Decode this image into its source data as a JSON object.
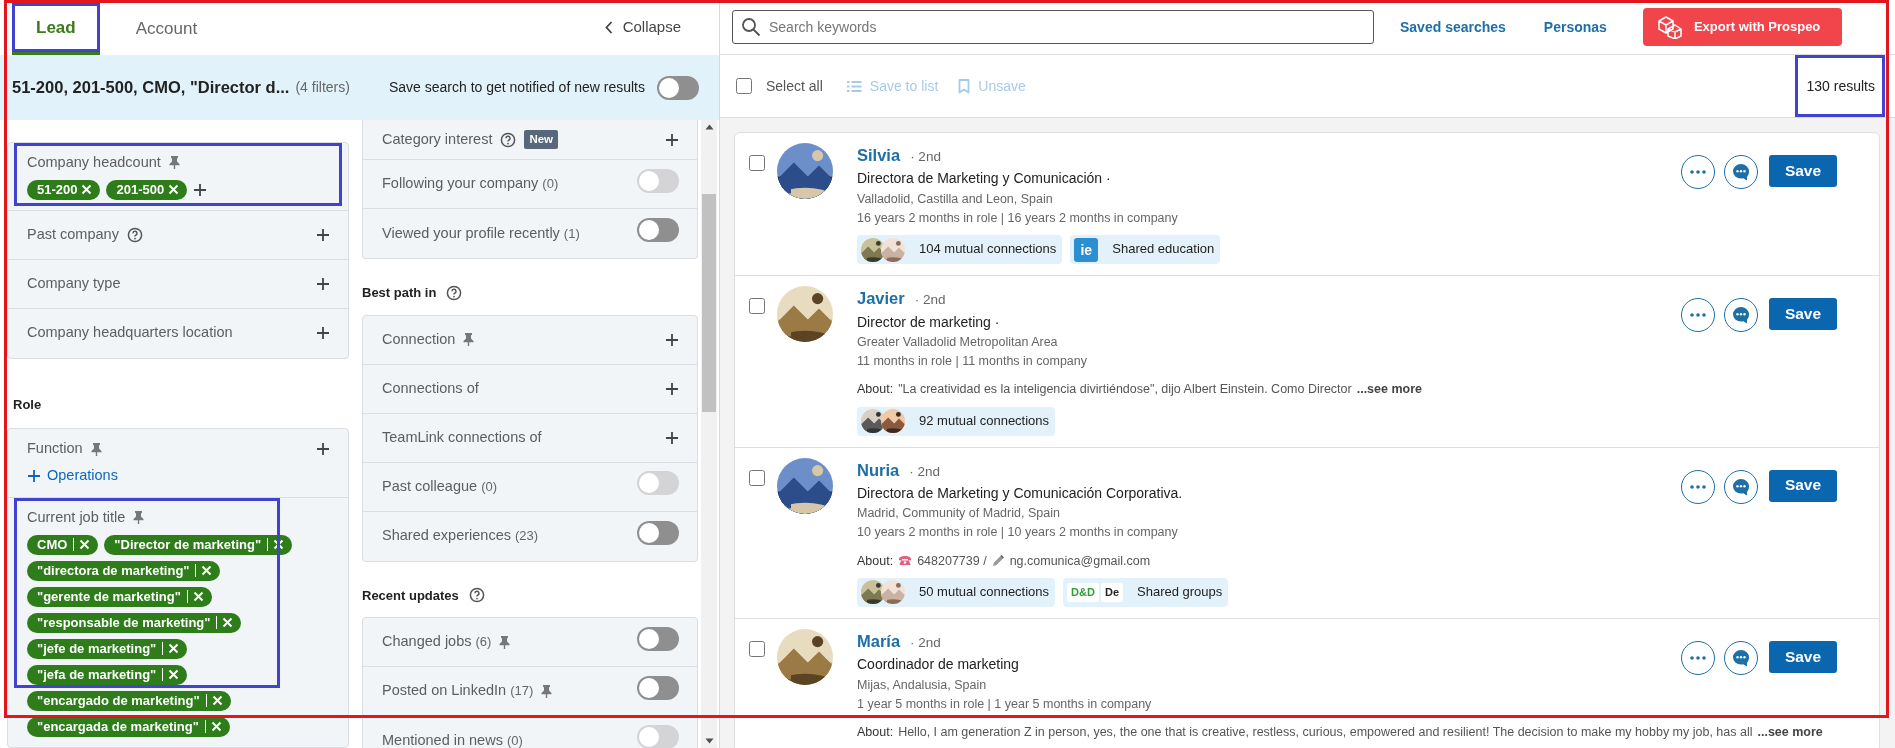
{
  "app": {
    "outlined": true
  },
  "tabs": [
    {
      "label": "Lead",
      "selected": true,
      "outlined": true
    },
    {
      "label": "Account",
      "selected": false,
      "outlined": false
    }
  ],
  "collapse": {
    "label": "Collapse"
  },
  "summary": {
    "text": "51-200, 201-500, CMO, \"Director d...",
    "count": "(4 filters)",
    "save_label": "Save search to get notified of new results",
    "on": false
  },
  "filter_columns": [
    {
      "sections": [
        {
          "filters": [
            {
              "label": "Company headcount",
              "kind": "chips",
              "pinned": true,
              "outlined": true,
              "chip_divider": false,
              "chips": [
                "51-200",
                "201-500"
              ]
            },
            {
              "label": "Past company",
              "kind": "add",
              "help": true
            },
            {
              "label": "Company type",
              "kind": "add"
            },
            {
              "label": "Company headquarters location",
              "kind": "add"
            }
          ]
        },
        {
          "heading": "Role",
          "filters": [
            {
              "label": "Function",
              "kind": "add",
              "pinned": true,
              "suggestion": "Operations"
            },
            {
              "label": "Current job title",
              "kind": "chips",
              "pinned": true,
              "outlined": true,
              "chip_divider": true,
              "chips": [
                "CMO",
                "\"Director de marketing\"",
                "\"directora de marketing\"",
                "\"gerente de marketing\"",
                "\"responsable de marketing\"",
                "\"jefe de marketing\"",
                "\"jefa de marketing\"",
                "\"encargado de marketing\"",
                "\"encargada de marketing\""
              ]
            }
          ]
        }
      ]
    },
    {
      "sections": [
        {
          "filters": [
            {
              "label": "Category interest",
              "kind": "add",
              "help": true,
              "badge": "New"
            },
            {
              "label": "Following your company",
              "kind": "toggle",
              "count": "(0)",
              "on": false,
              "disabled": true
            },
            {
              "label": "Viewed your profile recently",
              "kind": "toggle",
              "count": "(1)",
              "on": false,
              "disabled": false
            }
          ]
        },
        {
          "heading": "Best path in",
          "help": true,
          "filters": [
            {
              "label": "Connection",
              "kind": "add",
              "pinned": true
            },
            {
              "label": "Connections of",
              "kind": "add"
            },
            {
              "label": "TeamLink connections of",
              "kind": "add"
            },
            {
              "label": "Past colleague",
              "kind": "toggle",
              "count": "(0)",
              "on": false,
              "disabled": true
            },
            {
              "label": "Shared experiences",
              "kind": "toggle",
              "count": "(23)",
              "on": false,
              "disabled": false
            }
          ]
        },
        {
          "heading": "Recent updates",
          "help": true,
          "filters": [
            {
              "label": "Changed jobs",
              "kind": "toggle",
              "count": "(6)",
              "pinned": true,
              "on": false,
              "disabled": false
            },
            {
              "label": "Posted on LinkedIn",
              "kind": "toggle",
              "count": "(17)",
              "pinned": true,
              "on": false,
              "disabled": false
            },
            {
              "label": "Mentioned in news",
              "kind": "toggle",
              "count": "(0)",
              "on": false,
              "disabled": true
            }
          ]
        }
      ]
    }
  ],
  "results": {
    "search": {
      "placeholder": "Search keywords"
    },
    "links": [
      "Saved searches",
      "Personas"
    ],
    "export": "Export with Prospeo",
    "select_all": {
      "label": "Select all",
      "checked": false
    },
    "actions": [
      {
        "label": "Save to list",
        "kind": "list",
        "disabled": true
      },
      {
        "label": "Unsave",
        "kind": "bookmark",
        "disabled": true
      }
    ],
    "count": {
      "text": "130 results",
      "outlined": true
    },
    "leads": [
      {
        "name": "Silvia",
        "degree": "· 2nd",
        "title": "Directora de Marketing y Comunicación ·",
        "location": "Valladolid, Castilla and Leon, Spain",
        "tenure": "16 years 2 months in role | 16 years 2 months in company",
        "checked": false,
        "save": "Save",
        "badges": [
          {
            "kind": "mutual",
            "text": "104 mutual connections"
          },
          {
            "kind": "logo",
            "logos": [
              "ie"
            ],
            "text": "Shared education"
          }
        ]
      },
      {
        "name": "Javier",
        "degree": "· 2nd",
        "title": "Director de marketing ·",
        "location": "Greater Valladolid Metropolitan Area",
        "tenure": "11 months in role | 11 months in company",
        "checked": false,
        "save": "Save",
        "about": {
          "label": "About:",
          "text": "\"La creatividad es la inteligencia divirtiéndose\", dijo Albert Einstein. Como Director",
          "more": "...see more"
        },
        "badges": [
          {
            "kind": "mutual",
            "text": "92 mutual connections"
          }
        ]
      },
      {
        "name": "Nuria",
        "degree": "· 2nd",
        "title": "Directora de Marketing y Comunicación Corporativa.",
        "location": "Madrid, Community of Madrid, Spain",
        "tenure": "10 years 2 months in role | 10 years 2 months in company",
        "checked": false,
        "save": "Save",
        "about": {
          "label": "About:",
          "items": [
            {
              "kind": "phone",
              "text": "648207739 /"
            },
            {
              "kind": "pen",
              "text": "ng.comunica@gmail.com"
            }
          ]
        },
        "badges": [
          {
            "kind": "mutual",
            "text": "50 mutual connections"
          },
          {
            "kind": "logo",
            "logos": [
              "D&D",
              "De"
            ],
            "text": "Shared groups"
          }
        ]
      },
      {
        "name": "María",
        "degree": "· 2nd",
        "title": "Coordinador de marketing",
        "location": "Mijas, Andalusia, Spain",
        "tenure": "1 year 5 months in role | 1 year 5 months in company",
        "checked": false,
        "save": "Save",
        "about": {
          "label": "About:",
          "text": "Hello, I am generation Z in person, yes, the one that is creative, restless, curious, empowered and resilient! The decision to make my hobby my job, has all",
          "more": "...see more"
        }
      }
    ]
  }
}
